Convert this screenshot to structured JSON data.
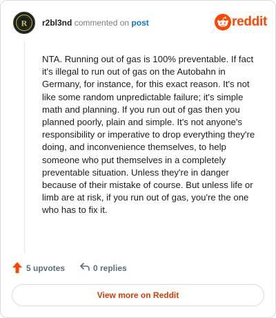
{
  "header": {
    "username": "r2bl3nd",
    "action": "commented on",
    "post_link": "post",
    "brand_name": "reddit",
    "avatar_letter": "R"
  },
  "comment": {
    "text": "NTA. Running out of gas is 100% preventable. If fact it's illegal to run out of gas on the Autobahn in Germany, for instance, for this exact reason. It's not like some random unpredictable failure; it's simple math and planning. If you run out of gas then you planned poorly, plain and simple. It's not anyone's responsibility or imperative to drop everything they're doing, and inconvenience themselves, to help someone who put themselves in a completely preventable situation. Unless they're in danger because of their mistake of course. But unless life or limb are at risk, if you run out of gas, you're the one who has to fix it."
  },
  "actions": {
    "upvotes_label": "5 upvotes",
    "replies_label": "0 replies"
  },
  "footer": {
    "view_more_label": "View more on Reddit"
  },
  "icons": {
    "upvote": "upvote-arrow-icon",
    "reply": "reply-arrow-icon",
    "brand": "reddit-snoo-icon"
  },
  "colors": {
    "brand_orange": "#ff4500",
    "link_blue": "#0079d3",
    "view_more_text": "#d93a00",
    "muted_text": "#7c7c7c"
  }
}
